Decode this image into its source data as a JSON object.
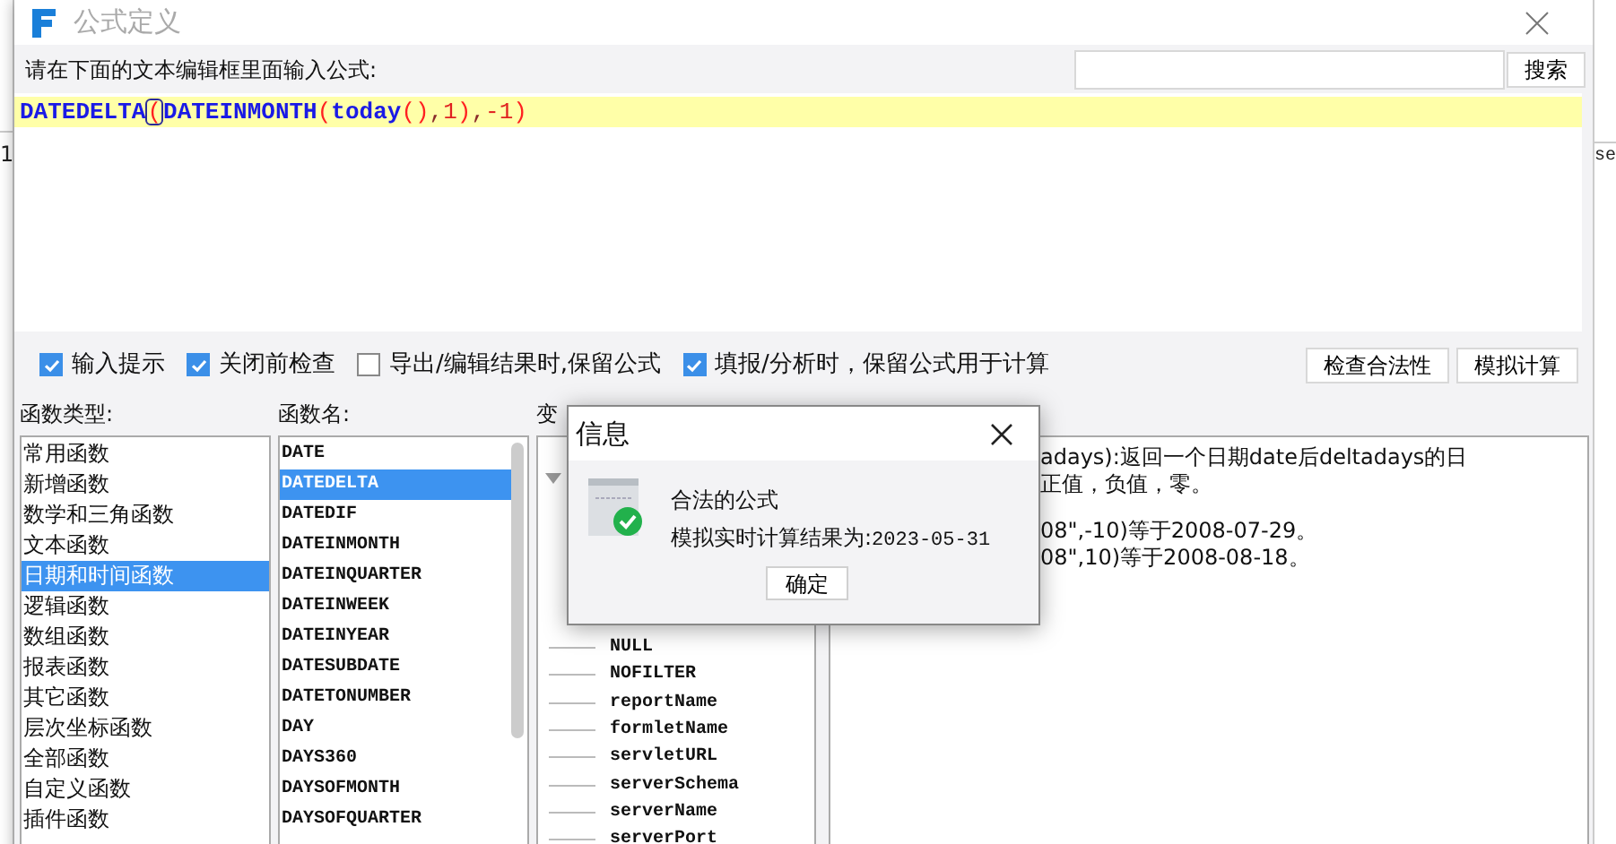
{
  "background": {
    "left_cell": "1",
    "right_cell": "se"
  },
  "window": {
    "title": "公式定义"
  },
  "prompt": {
    "label": "请在下面的文本编辑框里面输入公式:",
    "search_button": "搜索"
  },
  "formula": [
    {
      "text": "DATEDELTA",
      "kind": "name",
      "highlighted": false
    },
    {
      "text": "(",
      "kind": "bracket",
      "highlighted": true
    },
    {
      "text": "DATEINMONTH",
      "kind": "name",
      "highlighted": false
    },
    {
      "text": "(",
      "kind": "bracket",
      "highlighted": false
    },
    {
      "text": "today",
      "kind": "name",
      "highlighted": false
    },
    {
      "text": "()",
      "kind": "bracket",
      "highlighted": false
    },
    {
      "text": ",",
      "kind": "comma",
      "highlighted": false
    },
    {
      "text": "1",
      "kind": "number",
      "highlighted": false
    },
    {
      "text": ")",
      "kind": "bracket",
      "highlighted": false
    },
    {
      "text": ",",
      "kind": "comma",
      "highlighted": false
    },
    {
      "text": "-1",
      "kind": "number",
      "highlighted": false
    },
    {
      "text": ")",
      "kind": "bracket",
      "highlighted": false
    }
  ],
  "options": [
    {
      "label": "输入提示",
      "checked": true
    },
    {
      "label": "关闭前检查",
      "checked": true
    },
    {
      "label": "导出/编辑结果时,保留公式",
      "checked": false
    },
    {
      "label": "填报/分析时，保留公式用于计算",
      "checked": true
    }
  ],
  "actions": [
    "检查合法性",
    "模拟计算"
  ],
  "function_types": {
    "label": "函数类型:",
    "items": [
      {
        "label": "常用函数",
        "selected": false
      },
      {
        "label": "新增函数",
        "selected": false
      },
      {
        "label": "数学和三角函数",
        "selected": false
      },
      {
        "label": "文本函数",
        "selected": false
      },
      {
        "label": "日期和时间函数",
        "selected": true
      },
      {
        "label": "逻辑函数",
        "selected": false
      },
      {
        "label": "数组函数",
        "selected": false
      },
      {
        "label": "报表函数",
        "selected": false
      },
      {
        "label": "其它函数",
        "selected": false
      },
      {
        "label": "层次坐标函数",
        "selected": false
      },
      {
        "label": "全部函数",
        "selected": false
      },
      {
        "label": "自定义函数",
        "selected": false
      },
      {
        "label": "插件函数",
        "selected": false
      }
    ]
  },
  "function_names": {
    "label": "函数名:",
    "items": [
      {
        "label": "DATE",
        "selected": false
      },
      {
        "label": "DATEDELTA",
        "selected": true
      },
      {
        "label": "DATEDIF",
        "selected": false
      },
      {
        "label": "DATEINMONTH",
        "selected": false
      },
      {
        "label": "DATEINQUARTER",
        "selected": false
      },
      {
        "label": "DATEINWEEK",
        "selected": false
      },
      {
        "label": "DATEINYEAR",
        "selected": false
      },
      {
        "label": "DATESUBDATE",
        "selected": false
      },
      {
        "label": "DATETONUMBER",
        "selected": false
      },
      {
        "label": "DAY",
        "selected": false
      },
      {
        "label": "DAYS360",
        "selected": false
      },
      {
        "label": "DAYSOFMONTH",
        "selected": false
      },
      {
        "label": "DAYSOFQUARTER",
        "selected": false
      }
    ]
  },
  "variables": {
    "label": "变",
    "items": [
      "NULL",
      "NOFILTER",
      "reportName",
      "formletName",
      "servletURL",
      "serverSchema",
      "serverName",
      "serverPort"
    ]
  },
  "description": {
    "paragraphs": [
      [
        "adays):返回一个日期date后deltadays的日",
        "正值，负值，零。"
      ],
      [
        "08\",-10)等于2008-07-29。",
        "08\",10)等于2008-08-18。"
      ]
    ]
  },
  "message": {
    "title": "信息",
    "lines": [
      "合法的公式",
      "模拟实时计算结果为:"
    ],
    "result": "2023-05-31",
    "button": "确定"
  }
}
